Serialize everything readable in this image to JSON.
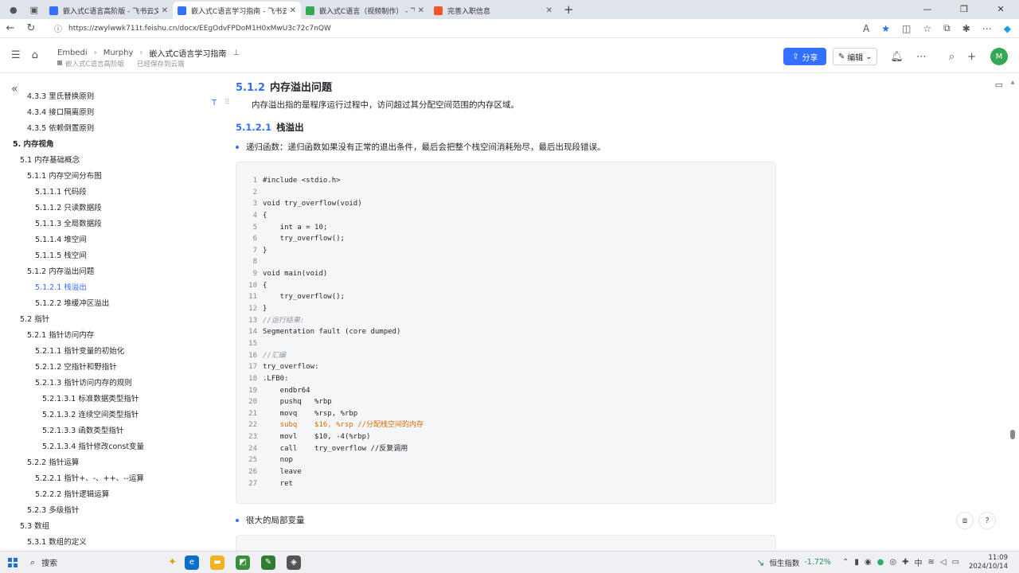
{
  "browser": {
    "tabs": [
      {
        "title": "嵌入式C语言高阶版 - 飞书云文档",
        "favicon_color": "#3370ff",
        "active": false
      },
      {
        "title": "嵌入式C语言学习指南 - 飞书云文档",
        "favicon_color": "#3370ff",
        "active": true
      },
      {
        "title": "嵌入式C语言（视频制作） - 飞书",
        "favicon_color": "#34a853",
        "active": false
      },
      {
        "title": "完善入职信息",
        "favicon_color": "#f5532d",
        "active": false
      }
    ],
    "url": "https://zwylwwk711t.feishu.cn/docx/EEgOdvFPDoM1H0xMwU3c72c7nQW"
  },
  "header": {
    "breadcrumbs": [
      "Embedi",
      "Murphy",
      "嵌入式C语言学习指南"
    ],
    "parent_doc": "嵌入式C语言高阶版",
    "save_status": "已经保存到云端",
    "share_label": "分享",
    "edit_label": "编辑",
    "avatar_initial": "M"
  },
  "outline": [
    {
      "label": "4.3.3 里氏替换原则",
      "level": 2
    },
    {
      "label": "4.3.4 接口隔离原则",
      "level": 2
    },
    {
      "label": "4.3.5 依赖倒置原则",
      "level": 2
    },
    {
      "label": "5. 内存视角",
      "level": 0
    },
    {
      "label": "5.1 内存基础概念",
      "level": 1
    },
    {
      "label": "5.1.1 内存空间分布图",
      "level": 2
    },
    {
      "label": "5.1.1.1 代码段",
      "level": 3
    },
    {
      "label": "5.1.1.2 只读数据段",
      "level": 3
    },
    {
      "label": "5.1.1.3 全局数据段",
      "level": 3
    },
    {
      "label": "5.1.1.4 堆空间",
      "level": 3
    },
    {
      "label": "5.1.1.5 栈空间",
      "level": 3
    },
    {
      "label": "5.1.2 内存溢出问题",
      "level": 2
    },
    {
      "label": "5.1.2.1 栈溢出",
      "level": 3,
      "active": true
    },
    {
      "label": "5.1.2.2 堆缓冲区溢出",
      "level": 3
    },
    {
      "label": "5.2 指针",
      "level": 1
    },
    {
      "label": "5.2.1 指针访问内存",
      "level": 2
    },
    {
      "label": "5.2.1.1 指针变量的初始化",
      "level": 3
    },
    {
      "label": "5.2.1.2 空指针和野指针",
      "level": 3
    },
    {
      "label": "5.2.1.3 指针访问内存的规则",
      "level": 3
    },
    {
      "label": "5.2.1.3.1 标准数据类型指针",
      "level": 4
    },
    {
      "label": "5.2.1.3.2 连续空间类型指针",
      "level": 4
    },
    {
      "label": "5.2.1.3.3 函数类型指针",
      "level": 4
    },
    {
      "label": "5.2.1.3.4 指针修改const变量",
      "level": 4
    },
    {
      "label": "5.2.2 指针运算",
      "level": 2
    },
    {
      "label": "5.2.2.1 指针+、-、++、--运算",
      "level": 3
    },
    {
      "label": "5.2.2.2 指针逻辑运算",
      "level": 3
    },
    {
      "label": "5.2.3 多级指针",
      "level": 2
    },
    {
      "label": "5.3 数组",
      "level": 1
    },
    {
      "label": "5.3.1 数组的定义",
      "level": 2
    }
  ],
  "doc": {
    "h3_num": "5.1.2",
    "h3_text": "内存溢出问题",
    "para": "内存溢出指的是程序运行过程中，访问超过其分配空间范围的内存区域。",
    "h4_num": "5.1.2.1",
    "h4_text": "栈溢出",
    "bullet1": "递归函数：递归函数如果没有正常的退出条件，最后会把整个栈空间消耗殆尽，最后出现段错误。",
    "bullet2": "很大的局部变量",
    "code": [
      "#include <stdio.h>",
      "",
      "void try_overflow(void)",
      "{",
      "    int a = 10;",
      "    try_overflow();",
      "}",
      "",
      "void main(void)",
      "{",
      "    try_overflow();",
      "}",
      "//运行结果:",
      "Segmentation fault (core dumped)",
      "",
      "//汇编",
      "try_overflow:",
      ".LFB0:",
      "    endbr64",
      "    pushq   %rbp",
      "    movq    %rsp, %rbp",
      "    subq    $16, %rsp //分配栈空间的内存",
      "    movl    $10, -4(%rbp)",
      "    call    try_overflow //反复调用",
      "    nop",
      "    leave",
      "    ret"
    ]
  },
  "taskbar": {
    "search_label": "搜索",
    "stock_name": "恒生指数",
    "stock_change": "-1.72%",
    "ime": "中",
    "time": "11:09",
    "date": "2024/10/14"
  }
}
